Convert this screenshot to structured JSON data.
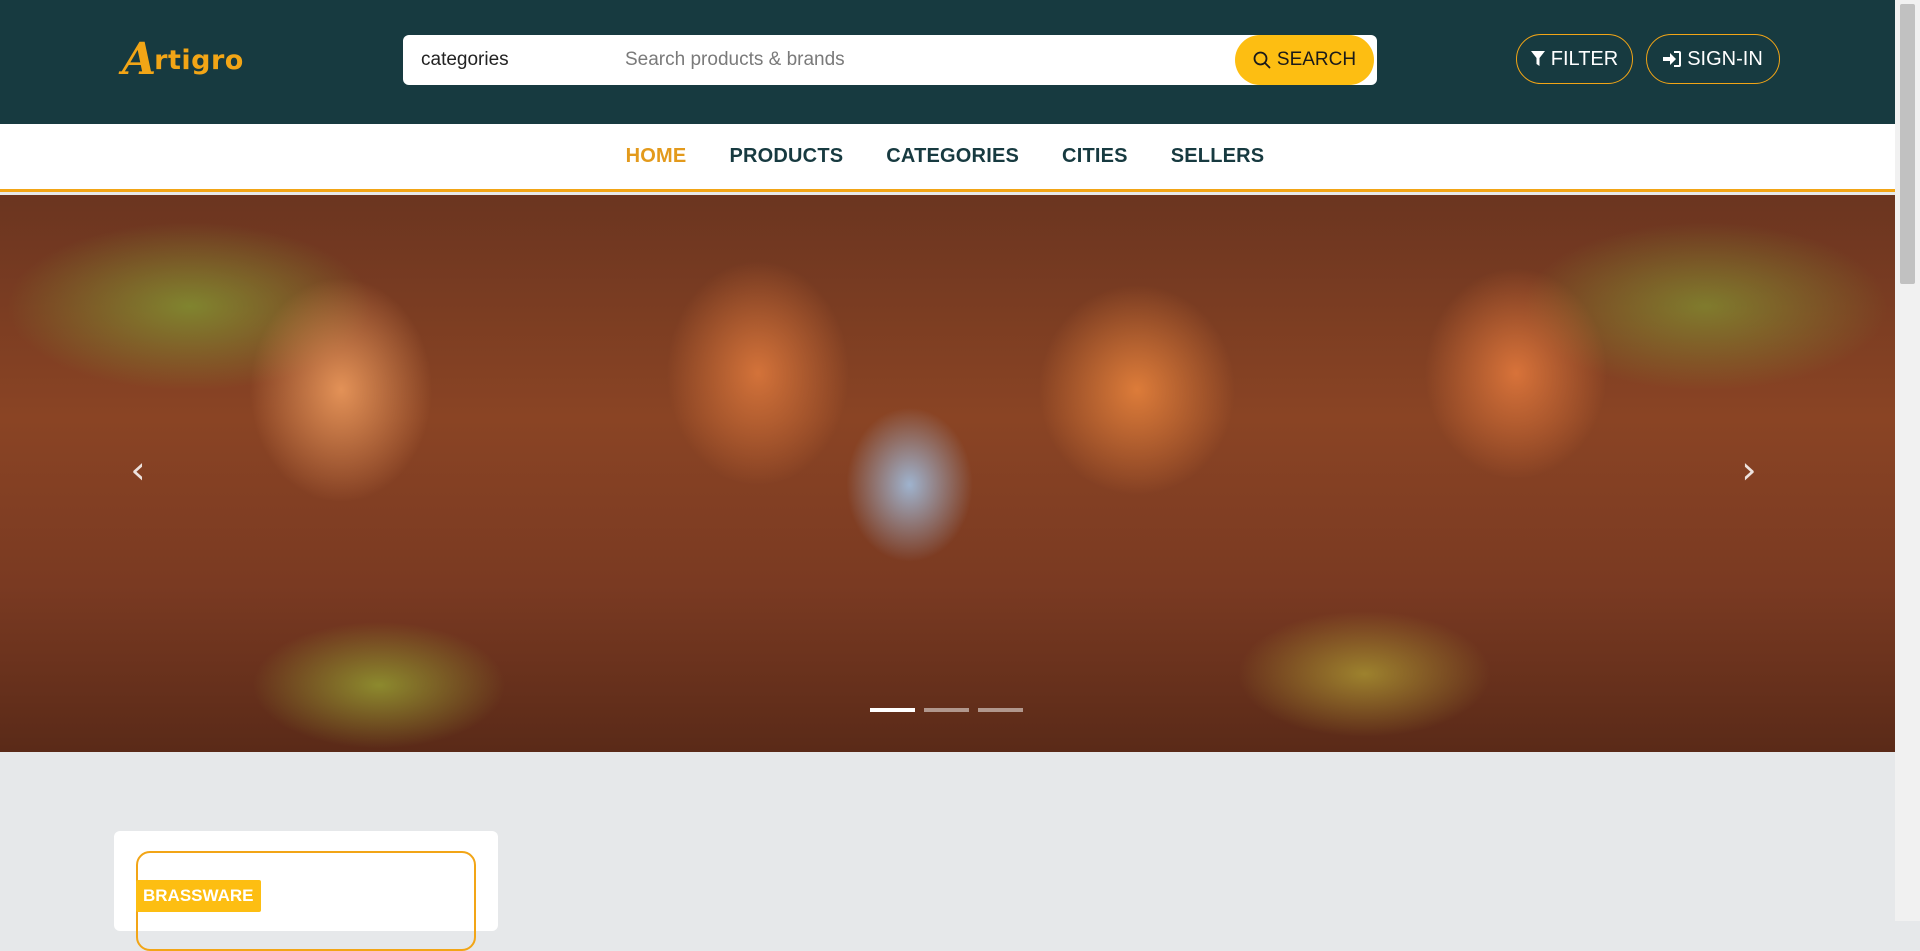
{
  "header": {
    "logo_text": "rtigro",
    "logo_initial": "A",
    "search": {
      "category": "categories",
      "placeholder": "Search products & brands",
      "button_label": "SEARCH"
    },
    "filter_label": "FILTER",
    "signin_label": "SIGN-IN"
  },
  "nav": {
    "items": [
      {
        "label": "HOME",
        "active": true
      },
      {
        "label": "PRODUCTS"
      },
      {
        "label": "CATEGORIES"
      },
      {
        "label": "CITIES"
      },
      {
        "label": "SELLERS"
      }
    ]
  },
  "hero": {
    "slide_count": 3,
    "active_slide": 1
  },
  "cards": [
    {
      "badge": "BRASSWARE"
    }
  ],
  "colors": {
    "header_bg": "#173a40",
    "accent": "#f2a516",
    "search_button": "#fdbe12",
    "nav_active": "#e39a1c"
  },
  "icons": [
    "search-icon",
    "filter-icon",
    "sign-in-icon",
    "chevron-left-icon",
    "chevron-right-icon"
  ]
}
